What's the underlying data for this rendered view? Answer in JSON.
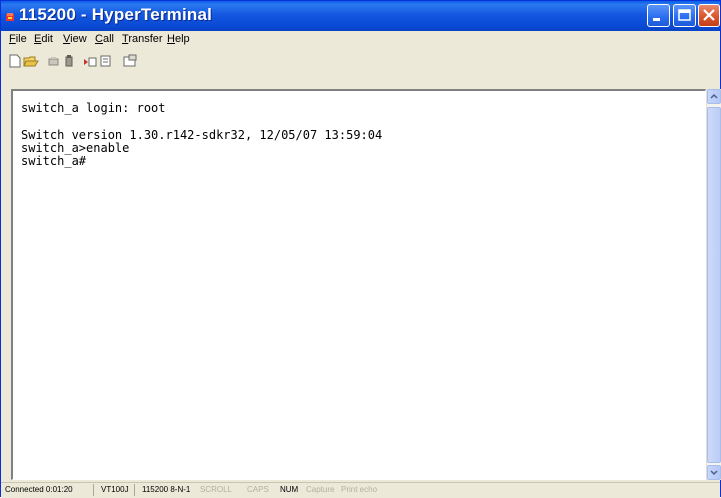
{
  "window": {
    "title": "115200 - HyperTerminal"
  },
  "menu": {
    "items": [
      "File",
      "Edit",
      "View",
      "Call",
      "Transfer",
      "Help"
    ]
  },
  "toolbar": {
    "icons": [
      "new-icon",
      "open-icon",
      "call-icon",
      "disconnect-icon",
      "send-icon",
      "receive-icon",
      "properties-icon"
    ]
  },
  "terminal": {
    "lines": [
      "switch_a login: root",
      "",
      "Switch version 1.30.r142-sdkr32, 12/05/07 13:59:04",
      "switch_a>enable",
      "switch_a#"
    ]
  },
  "status": {
    "connected": "Connected 0:01:20",
    "emulation": "VT100J",
    "port_settings": "115200 8-N-1",
    "scroll": "SCROLL",
    "caps": "CAPS",
    "num": "NUM",
    "capture": "Capture",
    "print_echo": "Print echo"
  },
  "colors": {
    "titlebar": "#0b4bd6",
    "chrome": "#ece9d8",
    "close_button": "#d9572f"
  }
}
